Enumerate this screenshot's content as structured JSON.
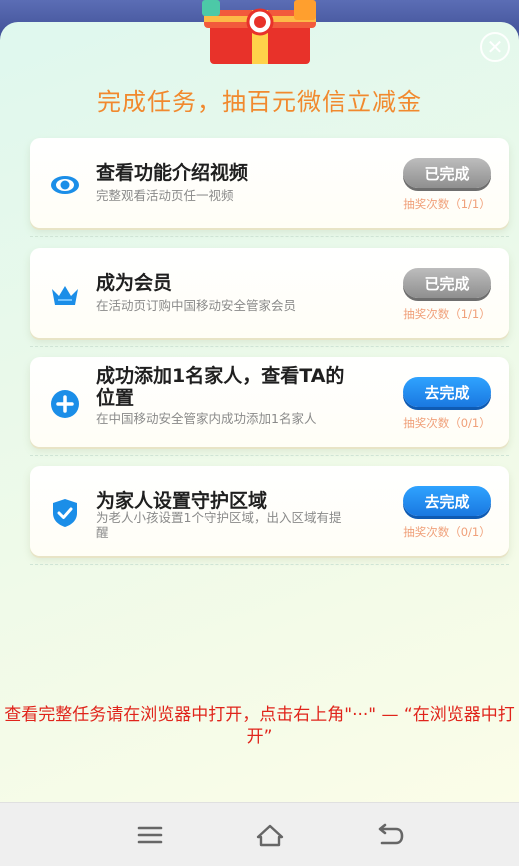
{
  "title": "完成任务，抽百元微信立减金",
  "close_icon": "close-icon",
  "gift_icon": "gift-box-icon",
  "tasks": [
    {
      "icon": "eye-icon",
      "title": "查看功能介绍视频",
      "desc": "完整观看活动页任一视频",
      "action": "已完成",
      "status": "done",
      "count": "抽奖次数（1/1）"
    },
    {
      "icon": "crown-icon",
      "title": "成为会员",
      "desc": "在活动页订购中国移动安全管家会员",
      "action": "已完成",
      "status": "done",
      "count": "抽奖次数（1/1）"
    },
    {
      "icon": "plus-circle-icon",
      "title": "成功添加1名家人，查看TA的位置",
      "desc": "在中国移动安全管家内成功添加1名家人",
      "action": "去完成",
      "status": "todo",
      "count": "抽奖次数（0/1）"
    },
    {
      "icon": "shield-check-icon",
      "title": "为家人设置守护区域",
      "desc": "为老人小孩设置1个守护区域，出入区域有提醒",
      "action": "去完成",
      "status": "todo",
      "count": "抽奖次数（0/1）"
    }
  ],
  "notice": "查看完整任务请在浏览器中打开，点击右上角\"···\" — “在浏览器中打开”",
  "navbar": {
    "menu_icon": "menu-icon",
    "home_icon": "home-icon",
    "back_icon": "back-icon"
  },
  "colors": {
    "title": "#f1892e",
    "done_button": "#a5a5a5",
    "todo_button": "#1f8ef0",
    "notice": "#e0241b"
  }
}
